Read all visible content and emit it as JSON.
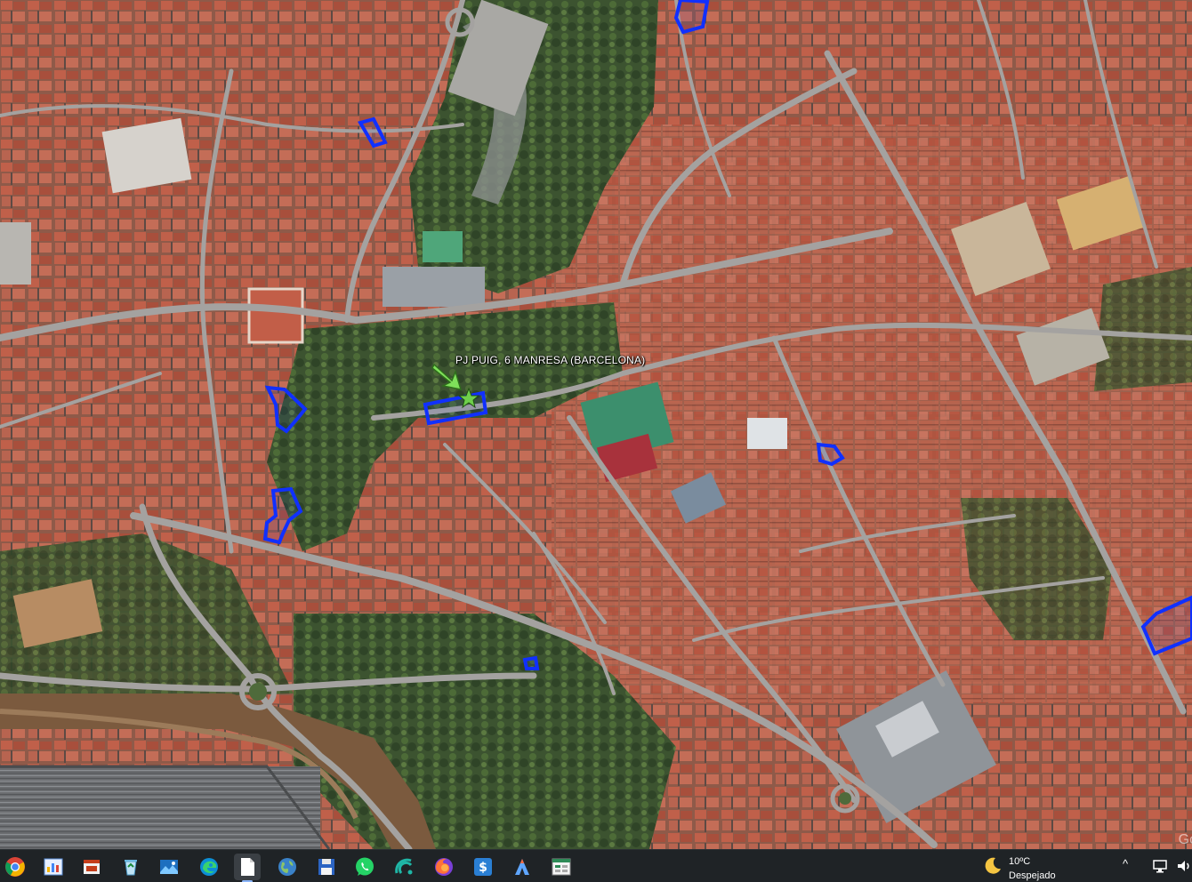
{
  "map": {
    "marker_label": "PJ PUIG, 6  MANRESA (BARCELONA)",
    "watermark": "Go",
    "colors": {
      "parcel_outline": "#1030ff",
      "marker_arrow": "#7fe05a",
      "roofs": "#b5533f",
      "roads": "#9a9a9a",
      "vegetation": "#3f5a2c",
      "river": "#6a4a33"
    }
  },
  "taskbar": {
    "apps": [
      {
        "name": "chrome-icon"
      },
      {
        "name": "app-chart-icon"
      },
      {
        "name": "powerpoint-icon"
      },
      {
        "name": "recycle-icon"
      },
      {
        "name": "photos-icon"
      },
      {
        "name": "edge-icon"
      },
      {
        "name": "file-icon"
      },
      {
        "name": "earth-icon"
      },
      {
        "name": "save-icon"
      },
      {
        "name": "whatsapp-icon"
      },
      {
        "name": "wifi-app-icon"
      },
      {
        "name": "firefox-icon"
      },
      {
        "name": "dollar-app-icon"
      },
      {
        "name": "arrow-app-icon"
      },
      {
        "name": "spreadsheet-icon"
      }
    ],
    "weather": {
      "temperature": "10ºC",
      "condition": "Despejado",
      "icon": "moon-icon"
    },
    "tray": {
      "chevron": "^",
      "icons": [
        "network-icon",
        "volume-icon"
      ]
    }
  }
}
